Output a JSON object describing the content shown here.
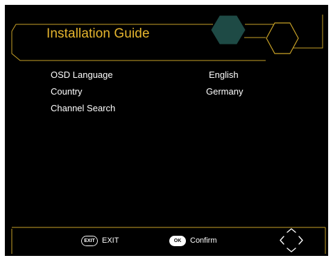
{
  "header": {
    "title": "Installation Guide"
  },
  "menu": {
    "items": [
      {
        "label": "OSD Language",
        "value": "English"
      },
      {
        "label": "Country",
        "value": "Germany"
      },
      {
        "label": "Channel Search",
        "value": ""
      }
    ]
  },
  "footer": {
    "exit_key": "EXIT",
    "exit_label": "EXIT",
    "ok_key": "OK",
    "ok_label": "Confirm",
    "nav_icon": "four-way-arrows-icon"
  },
  "colors": {
    "background": "#000000",
    "accent": "#c9a227",
    "title": "#e7b62e",
    "hexagon_fill": "#1e4a45",
    "text": "#ffffff"
  }
}
